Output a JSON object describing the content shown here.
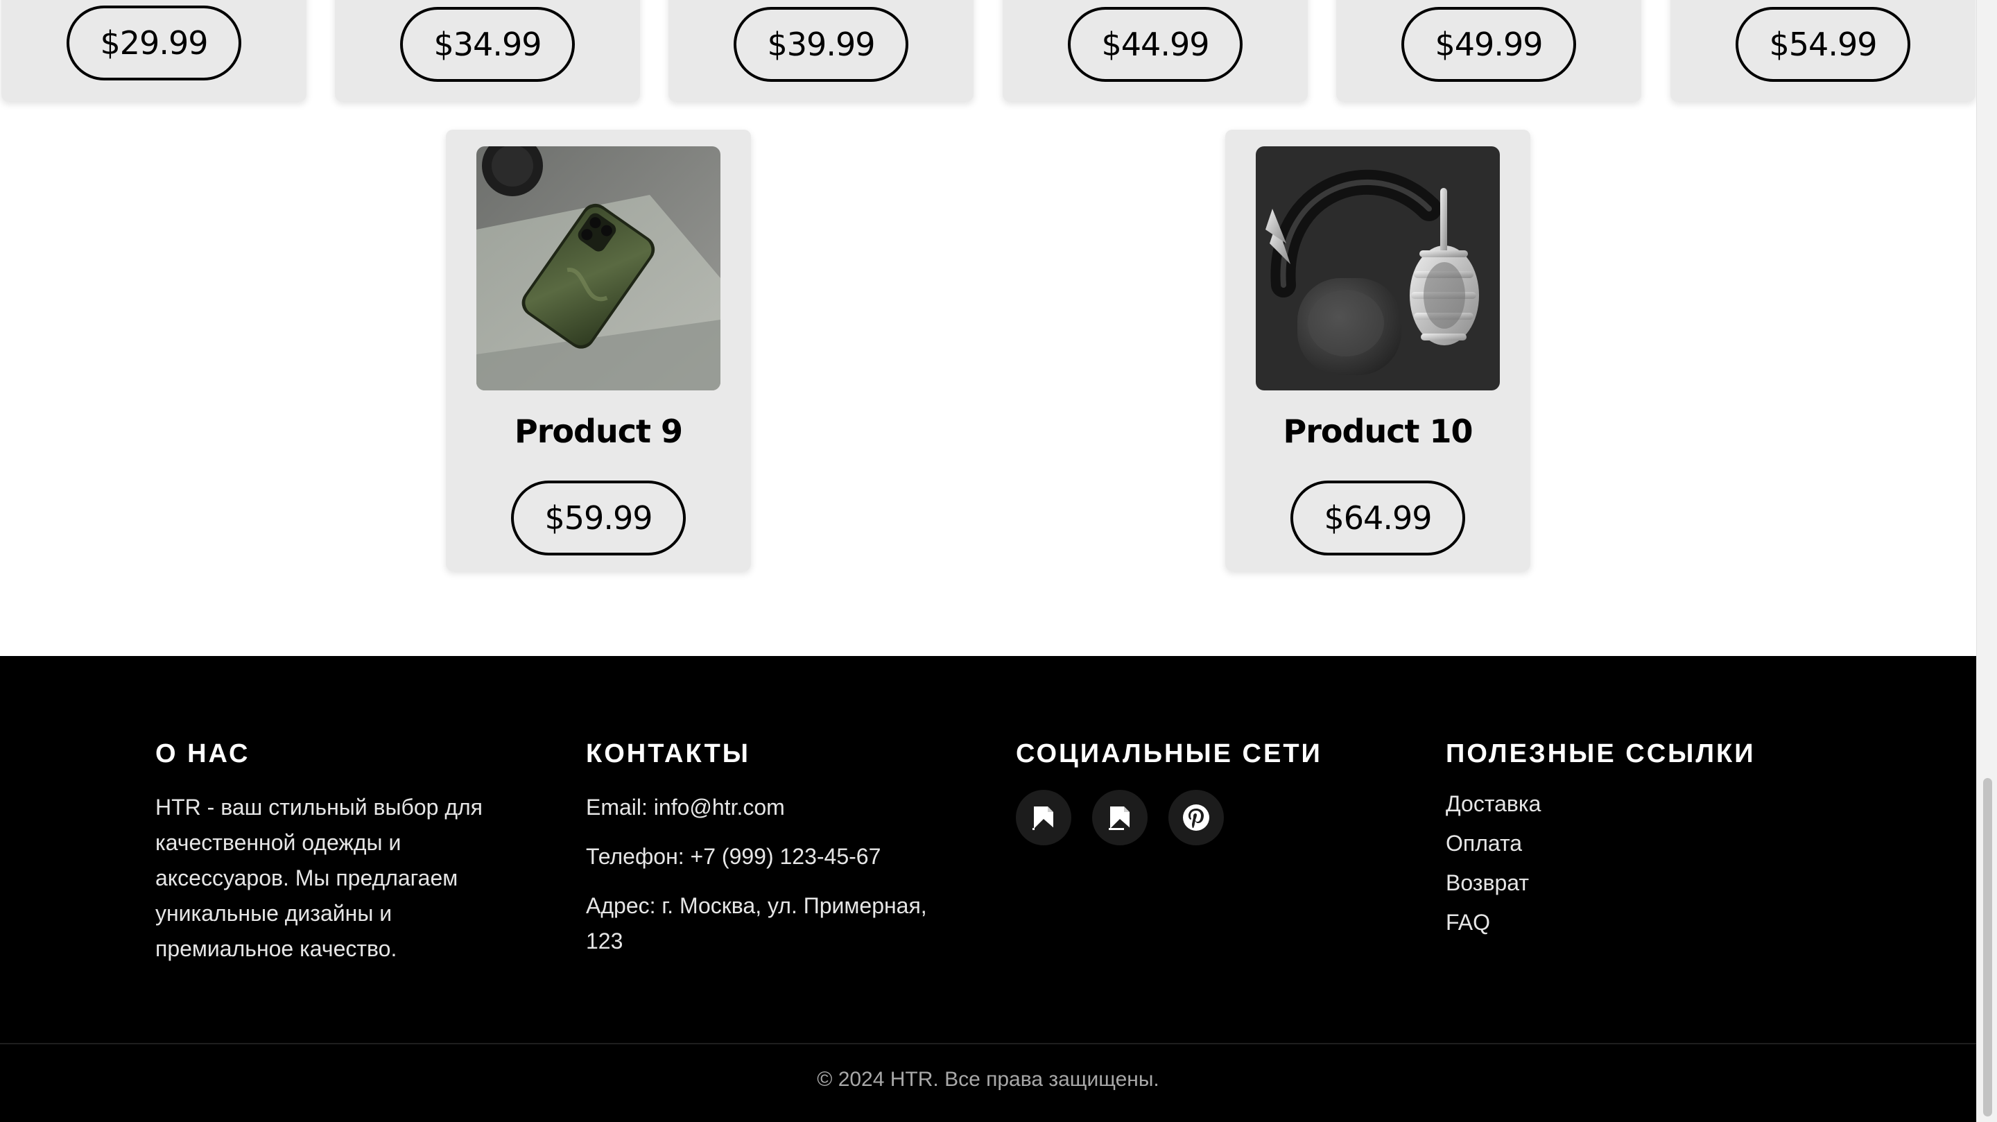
{
  "top_row_prices": [
    "$29.99",
    "$34.99",
    "$39.99",
    "$44.99",
    "$49.99",
    "$54.99"
  ],
  "products": [
    {
      "name": "Product 9",
      "price": "$59.99",
      "image": "green-phone-case-photo"
    },
    {
      "name": "Product 10",
      "price": "$64.99",
      "image": "headphones-with-silver-ornament-photo"
    }
  ],
  "footer": {
    "about": {
      "heading": "О НАС",
      "text": "HTR - ваш стильный выбор для качественной одежды и аксессуаров. Мы предлагаем уникальные дизайны и премиальное качество."
    },
    "contacts": {
      "heading": "КОНТАКТЫ",
      "email": "Email: info@htr.com",
      "phone": "Телефон: +7 (999) 123-45-67",
      "address": "Адрес: г. Москва, ул. Примерная, 123"
    },
    "social": {
      "heading": "СОЦИАЛЬНЫЕ СЕТИ",
      "icons": [
        "broken-image-icon",
        "broken-image-icon",
        "pinterest-icon"
      ]
    },
    "links": {
      "heading": "ПОЛЕЗНЫЕ ССЫЛКИ",
      "items": [
        "Доставка",
        "Оплата",
        "Возврат",
        "FAQ"
      ]
    },
    "copyright": "© 2024 HTR. Все права защищены."
  }
}
